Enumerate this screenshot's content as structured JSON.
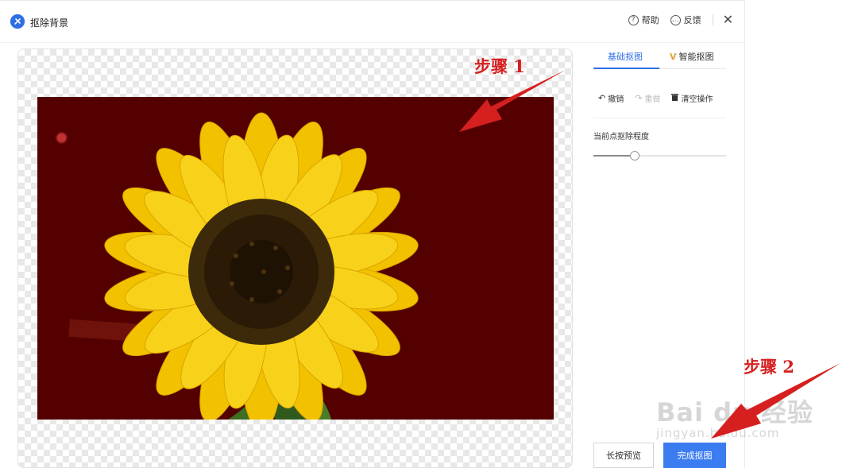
{
  "dialog": {
    "title": "抠除背景",
    "help_label": "帮助",
    "feedback_label": "反馈",
    "help_glyph": "?",
    "feedback_glyph": "…",
    "close_glyph": "✕"
  },
  "panel": {
    "tabs": [
      {
        "label": "基础抠图",
        "active": true
      },
      {
        "label": "智能抠图",
        "badge": "V",
        "active": false
      }
    ],
    "undo_label": "撤销",
    "redo_label": "重做",
    "clear_label": "清空操作",
    "degree_label": "当前点抠除程度",
    "degree_value": 0.31
  },
  "buttons": {
    "preview_label": "长按预览",
    "done_label": "完成抠图"
  },
  "annotations": {
    "step1": "步骤 1",
    "step2": "步骤 2"
  },
  "watermark": {
    "main": "Bai du 经验",
    "sub": "jingyan.baidu.com"
  },
  "colors": {
    "accent": "#2f6fe6",
    "photo_background": "#540000",
    "annotation_red": "#d61f1f"
  },
  "icons": {
    "undo": "undo-icon",
    "redo": "redo-icon",
    "clear": "trash-icon",
    "help": "help-circle-icon",
    "feedback": "feedback-bubble-icon",
    "close": "close-icon"
  }
}
